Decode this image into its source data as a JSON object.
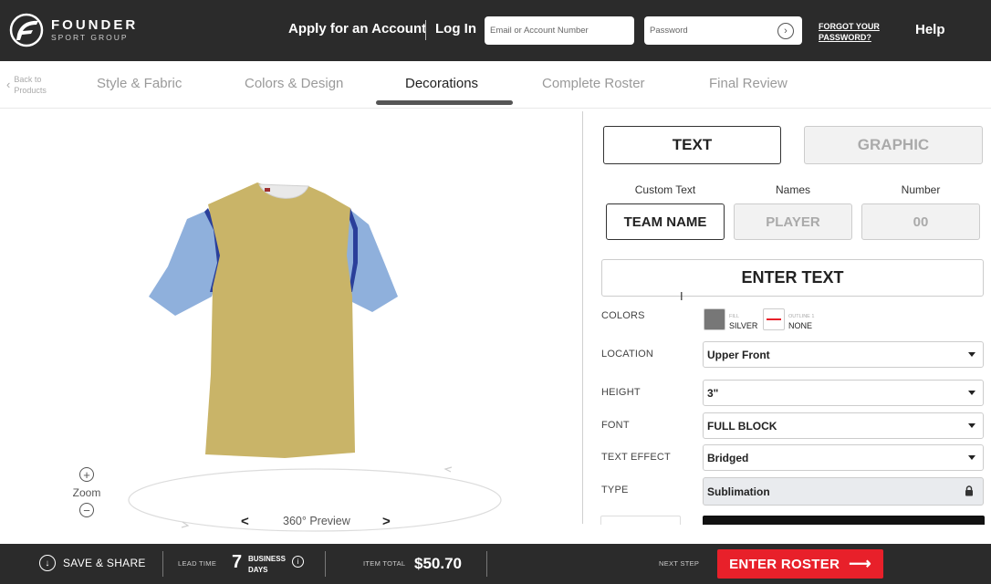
{
  "header": {
    "logo_name": "FOUNDER",
    "logo_sub": "SPORT GROUP",
    "apply_label": "Apply for an Account",
    "login_label": "Log In",
    "email_placeholder": "Email or Account Number",
    "password_placeholder": "Password",
    "forgot_label": "FORGOT YOUR PASSWORD?",
    "help_label": "Help"
  },
  "nav": {
    "back_label": "Back to Products",
    "steps": [
      "Style & Fabric",
      "Colors & Design",
      "Decorations",
      "Complete Roster",
      "Final Review"
    ],
    "active_step": "Decorations"
  },
  "preview": {
    "zoom_label": "Zoom",
    "rotate_label": "360° Preview",
    "prev_glyph": "<",
    "next_glyph": ">",
    "shirt_colors": {
      "body": "#c9b468",
      "sleeves": "#8fb0dc",
      "trim": "#2a3f9a"
    }
  },
  "decor": {
    "tabs": [
      "TEXT",
      "GRAPHIC"
    ],
    "active_tab": "TEXT",
    "option_labels": [
      "Custom Text",
      "Names",
      "Number"
    ],
    "options": [
      "TEAM NAME",
      "PLAYER",
      "00"
    ],
    "active_option": "TEAM NAME",
    "enter_text": "ENTER TEXT",
    "colors_label": "COLORS",
    "fill": {
      "caption": "FILL",
      "value": "SILVER",
      "color": "#777777"
    },
    "outline": {
      "caption": "OUTLINE 1",
      "value": "NONE",
      "color": "#e8202a"
    },
    "location_label": "LOCATION",
    "location_value": "Upper Front",
    "height_label": "HEIGHT",
    "height_value": "3\"",
    "font_label": "FONT",
    "font_value": "FULL BLOCK",
    "effect_label": "TEXT EFFECT",
    "effect_value": "Bridged",
    "type_label": "TYPE",
    "type_value": "Sublimation"
  },
  "footer": {
    "save_label": "SAVE & SHARE",
    "lead_time_caption": "LEAD TIME",
    "lead_time_value": "7",
    "lead_time_unit": "BUSINESS DAYS",
    "total_caption": "ITEM TOTAL",
    "total_value": "$50.70",
    "next_caption": "NEXT STEP",
    "cta_label": "ENTER ROSTER",
    "cta_color": "#e8202a"
  }
}
